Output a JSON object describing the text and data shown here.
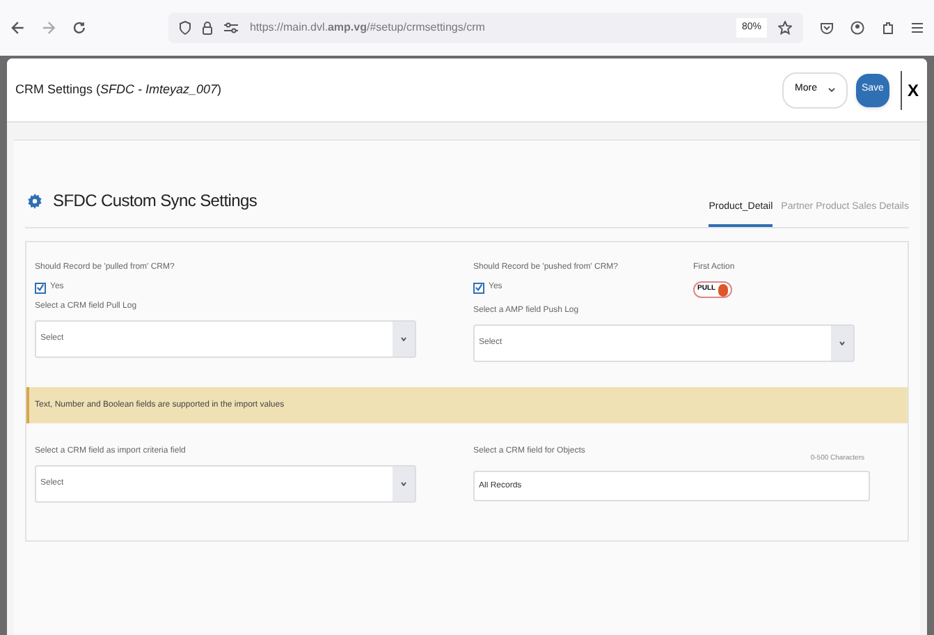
{
  "browser": {
    "url": "https://main.dvl.**amp.vg**/#setup/crmsettings/crm",
    "zoom": "80%"
  },
  "modal": {
    "title": "CRM Settings (*SFDC - Imteyaz_007*)",
    "more_button": "More",
    "save_button": "Save",
    "close_button": "X"
  },
  "section": {
    "title": "SFDC Custom Sync Settings",
    "tabs": [
      {
        "label": "Product_Detail",
        "selected": true
      },
      {
        "label": "Partner Product Sales Details",
        "selected": false
      }
    ]
  },
  "pull": {
    "label": "Should Record be 'pulled from' CRM?",
    "checkbox": "Yes",
    "checked": true,
    "select_label": "Select a CRM field Pull Log",
    "select": {
      "placeholder": "Select"
    }
  },
  "push": {
    "label": "Should Record be 'pushed from' CRM?",
    "checkbox": "Yes",
    "checked": true,
    "select_label": "Select a AMP field Push Log",
    "select": {
      "placeholder": "Select"
    }
  },
  "first_action": {
    "label": "First Action",
    "toggle": "PULL",
    "on": true
  },
  "notice": "Text, Number and Boolean fields are supported in the import values",
  "criteria": {
    "label": "Select a CRM field as import criteria field",
    "select": {
      "placeholder": "Select"
    }
  },
  "objects": {
    "label": "Select a CRM field for Objects",
    "hint": "0-500 Characters",
    "value": "All Records"
  }
}
